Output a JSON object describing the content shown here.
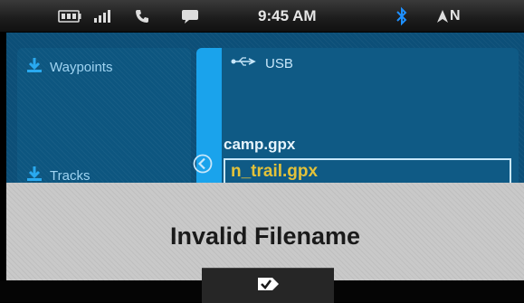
{
  "status_bar": {
    "time": "9:45 AM",
    "bluetooth_icon": "bluetooth-icon",
    "compass_label": "N",
    "icons": [
      "battery-icon",
      "signal-icon",
      "phone-icon",
      "message-icon",
      "bluetooth-icon",
      "compass-arrow-icon"
    ]
  },
  "sidebar": {
    "items": [
      {
        "label": "Waypoints",
        "icon": "download-icon"
      },
      {
        "label": "Tracks",
        "icon": "download-icon"
      }
    ]
  },
  "file_browser": {
    "source_label": "USB",
    "source_icon": "usb-icon",
    "files": [
      {
        "name": "camp.gpx"
      },
      {
        "name": "n_trail.gpx",
        "selected": true
      }
    ]
  },
  "dialog": {
    "message": "Invalid Filename",
    "confirm_icon": "checkmark-tag-icon"
  },
  "colors": {
    "accent": "#1aa3ec",
    "selected_text": "#e3c23a",
    "panel": "#0c4f78"
  }
}
